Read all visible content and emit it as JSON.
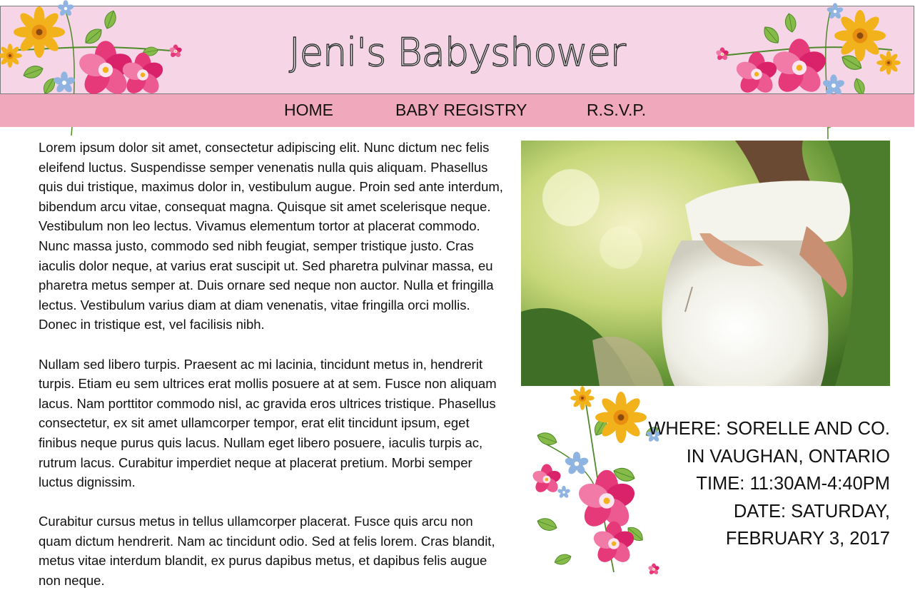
{
  "site": {
    "title": "Jeni's Babyshower"
  },
  "nav": {
    "items": [
      {
        "label": "HOME"
      },
      {
        "label": "BABY REGISTRY"
      },
      {
        "label": "R.S.V.P."
      }
    ]
  },
  "main": {
    "paragraphs": [
      "Lorem ipsum dolor sit amet, consectetur adipiscing elit. Nunc dictum nec felis eleifend luctus. Suspendisse semper venenatis nulla quis aliquam. Phasellus quis dui tristique, maximus dolor in, vestibulum augue. Proin sed ante interdum, bibendum arcu vitae, consequat magna. Quisque sit amet scelerisque neque. Vestibulum non leo lectus. Vivamus elementum tortor at placerat commodo. Nunc massa justo, commodo sed nibh feugiat, semper tristique justo. Cras iaculis dolor neque, at varius erat suscipit ut. Sed pharetra pulvinar massa, eu pharetra metus semper at. Duis ornare sed neque non auctor. Nulla et fringilla lectus. Vestibulum varius diam at diam venenatis, vitae fringilla orci mollis. Donec in tristique est, vel facilisis nibh.",
      "Nullam sed libero turpis. Praesent ac mi lacinia, tincidunt metus in, hendrerit turpis. Etiam eu sem ultrices erat mollis posuere at at sem. Fusce non aliquam lacus. Nam porttitor commodo nisl, ac gravida eros ultrices tristique. Phasellus consectetur, ex sit amet ullamcorper tempor, erat elit tincidunt ipsum, eget finibus neque purus quis lacus. Nullam eget libero posuere, iaculis turpis ac, rutrum lacus. Curabitur imperdiet neque at placerat pretium. Morbi semper luctus dignissim.",
      "Curabitur cursus metus in tellus ullamcorper placerat. Fusce quis arcu non quam dictum hendrerit. Nam ac tincidunt odio. Sed at felis lorem. Cras blandit, metus vitae interdum blandit, ex purus dapibus metus, et dapibus felis augue non neque."
    ]
  },
  "event": {
    "where": "WHERE: SORELLE AND CO. IN VAUGHAN, ONTARIO",
    "time": "TIME: 11:30AM-4:40PM",
    "date": "DATE: SATURDAY, FEBRUARY 3, 2017"
  },
  "images": {
    "photo": "pregnant-woman-photo",
    "floral_left": "floral-bouquet-icon",
    "floral_right": "floral-bouquet-icon",
    "floral_details": "floral-bouquet-icon"
  },
  "colors": {
    "header_bg": "#f6d6e6",
    "nav_bg": "#f0a8bc",
    "petal_pink": "#e6397a",
    "petal_yellow": "#f2b21b",
    "petal_blue": "#8fb4e2",
    "leaf_green": "#86bb4a"
  }
}
